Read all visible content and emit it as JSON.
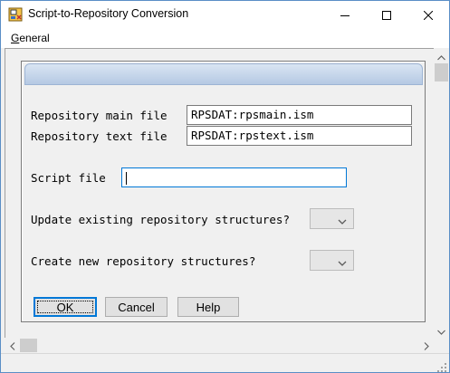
{
  "window": {
    "title": "Script-to-Repository Conversion"
  },
  "menubar": {
    "items": [
      {
        "label": "General",
        "accelerator": "G",
        "rest": "eneral"
      }
    ]
  },
  "form": {
    "repo_main_label": "Repository main file",
    "repo_main_value": "RPSDAT:rpsmain.ism",
    "repo_text_label": "Repository text file",
    "repo_text_value": "RPSDAT:rpstext.ism",
    "script_label": "Script file",
    "script_value": "",
    "update_label": "Update existing repository structures?",
    "update_value": "",
    "create_label": "Create new repository structures?",
    "create_value": ""
  },
  "buttons": {
    "ok": "OK",
    "cancel": "Cancel",
    "help": "Help"
  },
  "icons": {
    "app": "conversion-app-icon",
    "minimize": "minimize-icon",
    "maximize": "maximize-icon",
    "close": "close-icon"
  },
  "colors": {
    "accent": "#0078d7",
    "dialog_header": "#b5c9e3"
  }
}
